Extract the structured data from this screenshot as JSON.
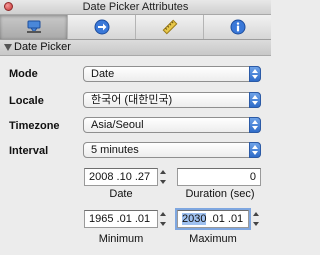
{
  "window": {
    "title": "Date Picker Attributes"
  },
  "tabs": [
    {
      "icon": "inspector-attributes-icon",
      "active": true
    },
    {
      "icon": "connections-arrow-icon",
      "active": false
    },
    {
      "icon": "size-ruler-icon",
      "active": false
    },
    {
      "icon": "identity-info-icon",
      "active": false
    }
  ],
  "section": {
    "title": "Date Picker"
  },
  "rows": {
    "mode": {
      "label": "Mode",
      "value": "Date"
    },
    "locale": {
      "label": "Locale",
      "value": "한국어 (대한민국)"
    },
    "timezone": {
      "label": "Timezone",
      "value": "Asia/Seoul"
    },
    "interval": {
      "label": "Interval",
      "value": "5 minutes"
    }
  },
  "date_field": {
    "value": "2008 .10 .27",
    "caption": "Date"
  },
  "duration_field": {
    "value": "0",
    "caption": "Duration (sec)"
  },
  "minimum_field": {
    "value": "1965 .01 .01",
    "caption": "Minimum"
  },
  "maximum_field": {
    "year": "2030",
    "rest": " .01 .01",
    "caption": "Maximum"
  },
  "colors": {
    "accent": "#3d7bd6",
    "selection": "#9fc1f0",
    "panel": "#ececec"
  }
}
